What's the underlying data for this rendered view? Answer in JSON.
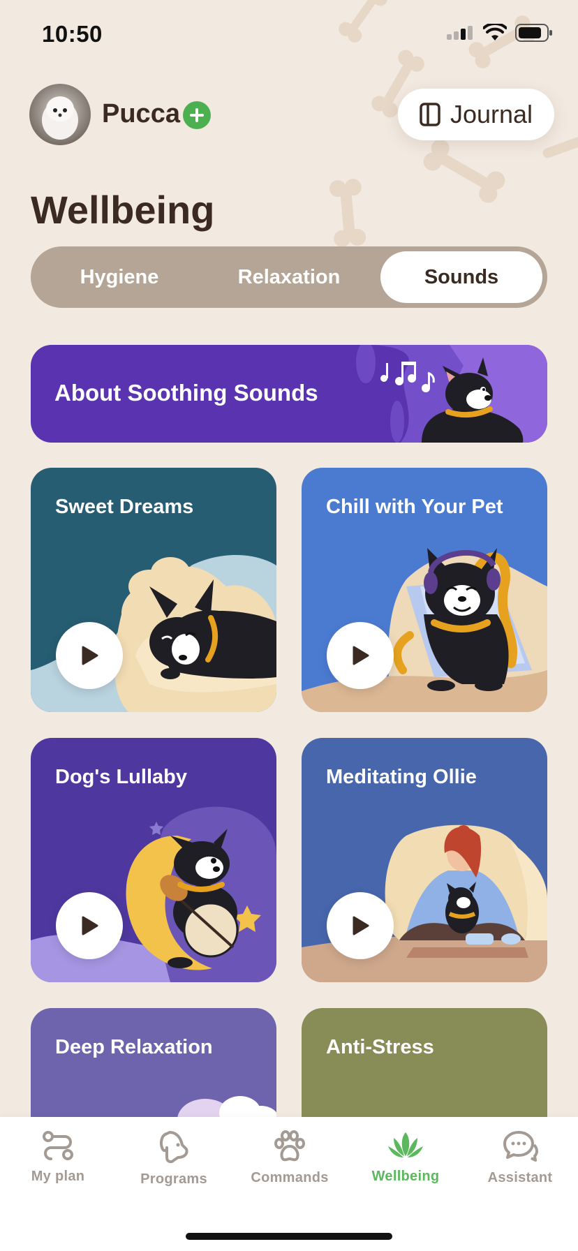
{
  "status_bar": {
    "time": "10:50"
  },
  "profile": {
    "pet_name": "Pucca"
  },
  "header": {
    "journal_label": "Journal"
  },
  "page": {
    "title": "Wellbeing"
  },
  "segments": [
    {
      "label": "Hygiene",
      "active": false
    },
    {
      "label": "Relaxation",
      "active": false
    },
    {
      "label": "Sounds",
      "active": true
    }
  ],
  "banner": {
    "title": "About Soothing Sounds"
  },
  "cards": [
    {
      "title": "Sweet Dreams",
      "color": "#275d72"
    },
    {
      "title": "Chill with Your Pet",
      "color": "#4b7bd1"
    },
    {
      "title": "Dog's Lullaby",
      "color": "#4e38a0"
    },
    {
      "title": "Meditating Ollie",
      "color": "#4766ac"
    },
    {
      "title": "Deep Relaxation",
      "color": "#6e63ad"
    },
    {
      "title": "Anti-Stress",
      "color": "#888d57"
    }
  ],
  "tabs": [
    {
      "label": "My plan",
      "icon": "route-icon",
      "active": false
    },
    {
      "label": "Programs",
      "icon": "dog-head-icon",
      "active": false
    },
    {
      "label": "Commands",
      "icon": "paw-icon",
      "active": false
    },
    {
      "label": "Wellbeing",
      "icon": "lotus-icon",
      "active": true
    },
    {
      "label": "Assistant",
      "icon": "chat-bubbles-icon",
      "active": false
    }
  ],
  "colors": {
    "background": "#f2e9e1",
    "accent_green": "#5cb85c",
    "segment_track": "#b4a596",
    "banner": "#5a34b0"
  }
}
